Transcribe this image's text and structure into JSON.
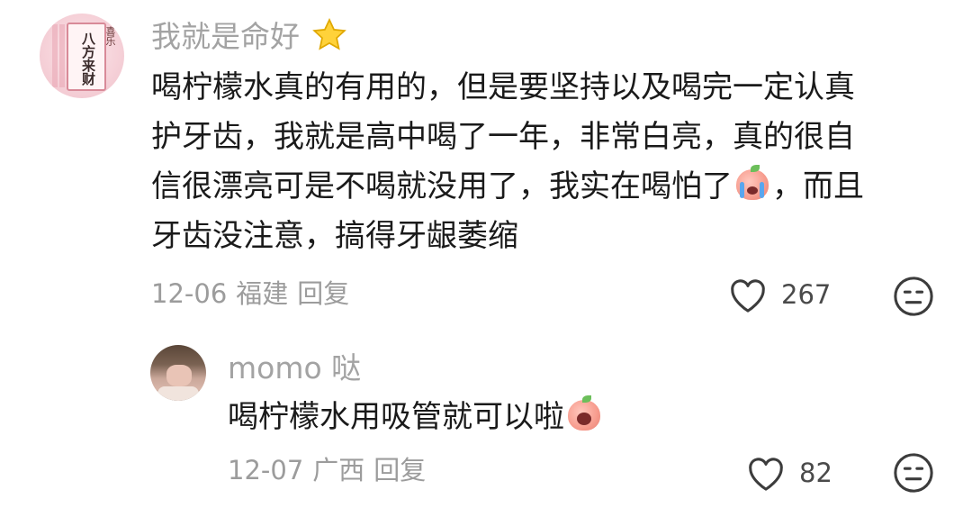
{
  "comments": [
    {
      "username": "我就是命好",
      "username_emoji": "star",
      "text_lines": [
        "喝柠檬水真的有用的，但是要坚持以及喝完一定认真",
        "护牙齿，我就是高中喝了一年，非常白亮，真的很自",
        "信很漂亮可是不喝就没用了，我实在喝怕了",
        "牙齿没注意，搞得牙龈萎缩"
      ],
      "inline_emoji": "crying-peach-emoji",
      "text_line3_suffix": "，而且",
      "avatar_text": "八方来财",
      "avatar_side_text": "喜乐",
      "date": "12-06",
      "location": "福建",
      "reply_label": "回复",
      "like_count": "267"
    },
    {
      "username": "momo",
      "username_suffix": "哒",
      "text_lines": [
        "喝柠檬水用吸管就可以啦"
      ],
      "inline_emoji": "shocked-peach-emoji",
      "date": "12-07",
      "location": "广西",
      "reply_label": "回复",
      "like_count": "82"
    }
  ],
  "colors": {
    "username": "#a3a3a3",
    "text": "#1a1a1a",
    "meta": "#9c9c9c",
    "icon": "#4a4a4a"
  }
}
